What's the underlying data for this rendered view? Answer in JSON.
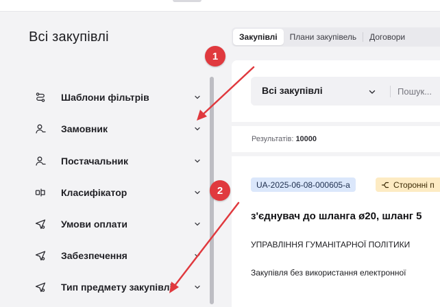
{
  "page": {
    "title": "Всі закупівлі"
  },
  "filters": [
    {
      "label": "Шаблони фільтрів",
      "icon": "route-icon"
    },
    {
      "label": "Замовник",
      "icon": "user-icon"
    },
    {
      "label": "Постачальник",
      "icon": "user-icon"
    },
    {
      "label": "Класифікатор",
      "icon": "classifier-icon"
    },
    {
      "label": "Умови оплати",
      "icon": "send-icon"
    },
    {
      "label": "Забезпечення",
      "icon": "send-icon"
    },
    {
      "label": "Тип предмету закупівлі",
      "icon": "send-icon"
    }
  ],
  "tabs": [
    {
      "label": "Закупівлі",
      "active": true
    },
    {
      "label": "Плани закупівель",
      "active": false
    },
    {
      "label": "Договори",
      "active": false
    }
  ],
  "search": {
    "select_value": "Всі закупівлі",
    "placeholder": "Пошук..."
  },
  "results": {
    "label": "Результатів:",
    "count": "10000"
  },
  "tender": {
    "id": "UA-2025-06-08-000605-a",
    "party_badge": "Сторонні п",
    "title": "з'єднувач до шланга ø20, шланг 5",
    "organization": "УПРАВЛІННЯ ГУМАНІТАРНОЇ ПОЛІТИКИ",
    "method": "Закупівля без використання електронної"
  },
  "annotations": [
    {
      "label": "1"
    },
    {
      "label": "2"
    }
  ],
  "colors": {
    "background": "#f3f3f5",
    "card": "#ffffff",
    "annotation_red": "#e0393e",
    "id_badge": "#dbe7fb",
    "party_badge": "#fdebc3"
  }
}
